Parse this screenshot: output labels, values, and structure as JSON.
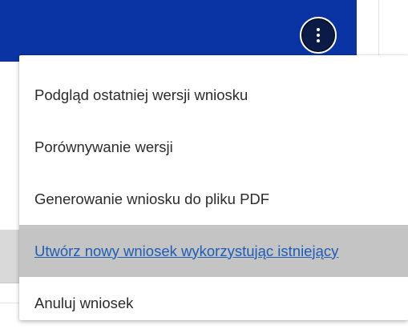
{
  "header": {
    "bar_color": "#0a34a3",
    "more_button_icon": "kebab-vertical-dots"
  },
  "menu": {
    "items": [
      {
        "label": "Podgląd ostatniej wersji wniosku",
        "active": false
      },
      {
        "label": "Porównywanie wersji",
        "active": false
      },
      {
        "label": "Generowanie wniosku do pliku PDF",
        "active": false
      },
      {
        "label": "Utwórz nowy wniosek wykorzystując istniejący",
        "active": true
      },
      {
        "label": "Anuluj wniosek",
        "active": false
      }
    ]
  },
  "colors": {
    "accent": "#0a34a3",
    "link": "#1e5cb5",
    "hover_bg": "#c4c4c4",
    "text": "#2b2b2b"
  }
}
